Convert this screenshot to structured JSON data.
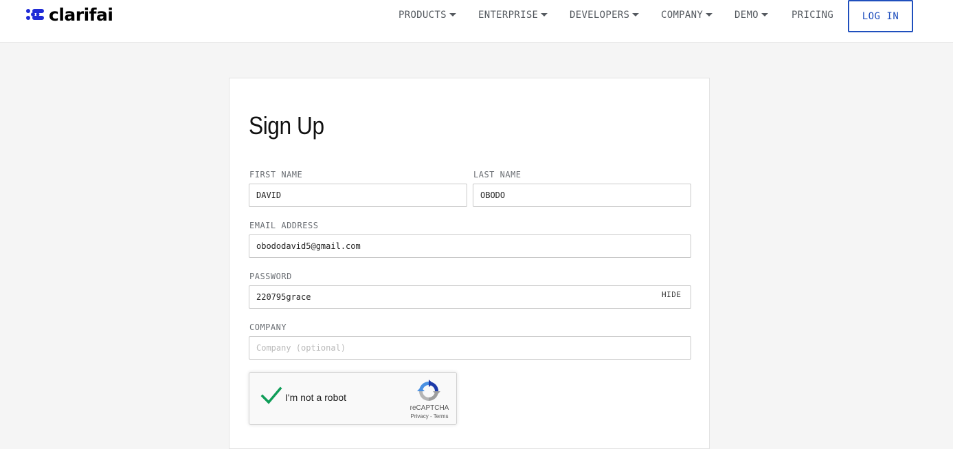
{
  "brand": {
    "name": "clarifai",
    "color": "#1f2bd6"
  },
  "nav": {
    "items": [
      {
        "label": "PRODUCTS",
        "dropdown": true
      },
      {
        "label": "ENTERPRISE",
        "dropdown": true
      },
      {
        "label": "DEVELOPERS",
        "dropdown": true
      },
      {
        "label": "COMPANY",
        "dropdown": true
      },
      {
        "label": "DEMO",
        "dropdown": true
      },
      {
        "label": "PRICING",
        "dropdown": false
      }
    ],
    "login_label": "LOG IN",
    "accent": "#1f4fbd"
  },
  "form": {
    "title": "Sign Up",
    "first_name": {
      "label": "FIRST NAME",
      "value": "DAVID"
    },
    "last_name": {
      "label": "LAST NAME",
      "value": "OBODO"
    },
    "email": {
      "label": "EMAIL ADDRESS",
      "value": "obododavid5@gmail.com"
    },
    "password": {
      "label": "PASSWORD",
      "value": "220795grace",
      "toggle_label": "HIDE"
    },
    "company": {
      "label": "COMPANY",
      "value": "",
      "placeholder": "Company (optional)"
    }
  },
  "captcha": {
    "checked": true,
    "label": "I'm not a robot",
    "brand": "reCAPTCHA",
    "privacy": "Privacy",
    "separator": " - ",
    "terms": "Terms",
    "check_color": "#0f9d58"
  }
}
